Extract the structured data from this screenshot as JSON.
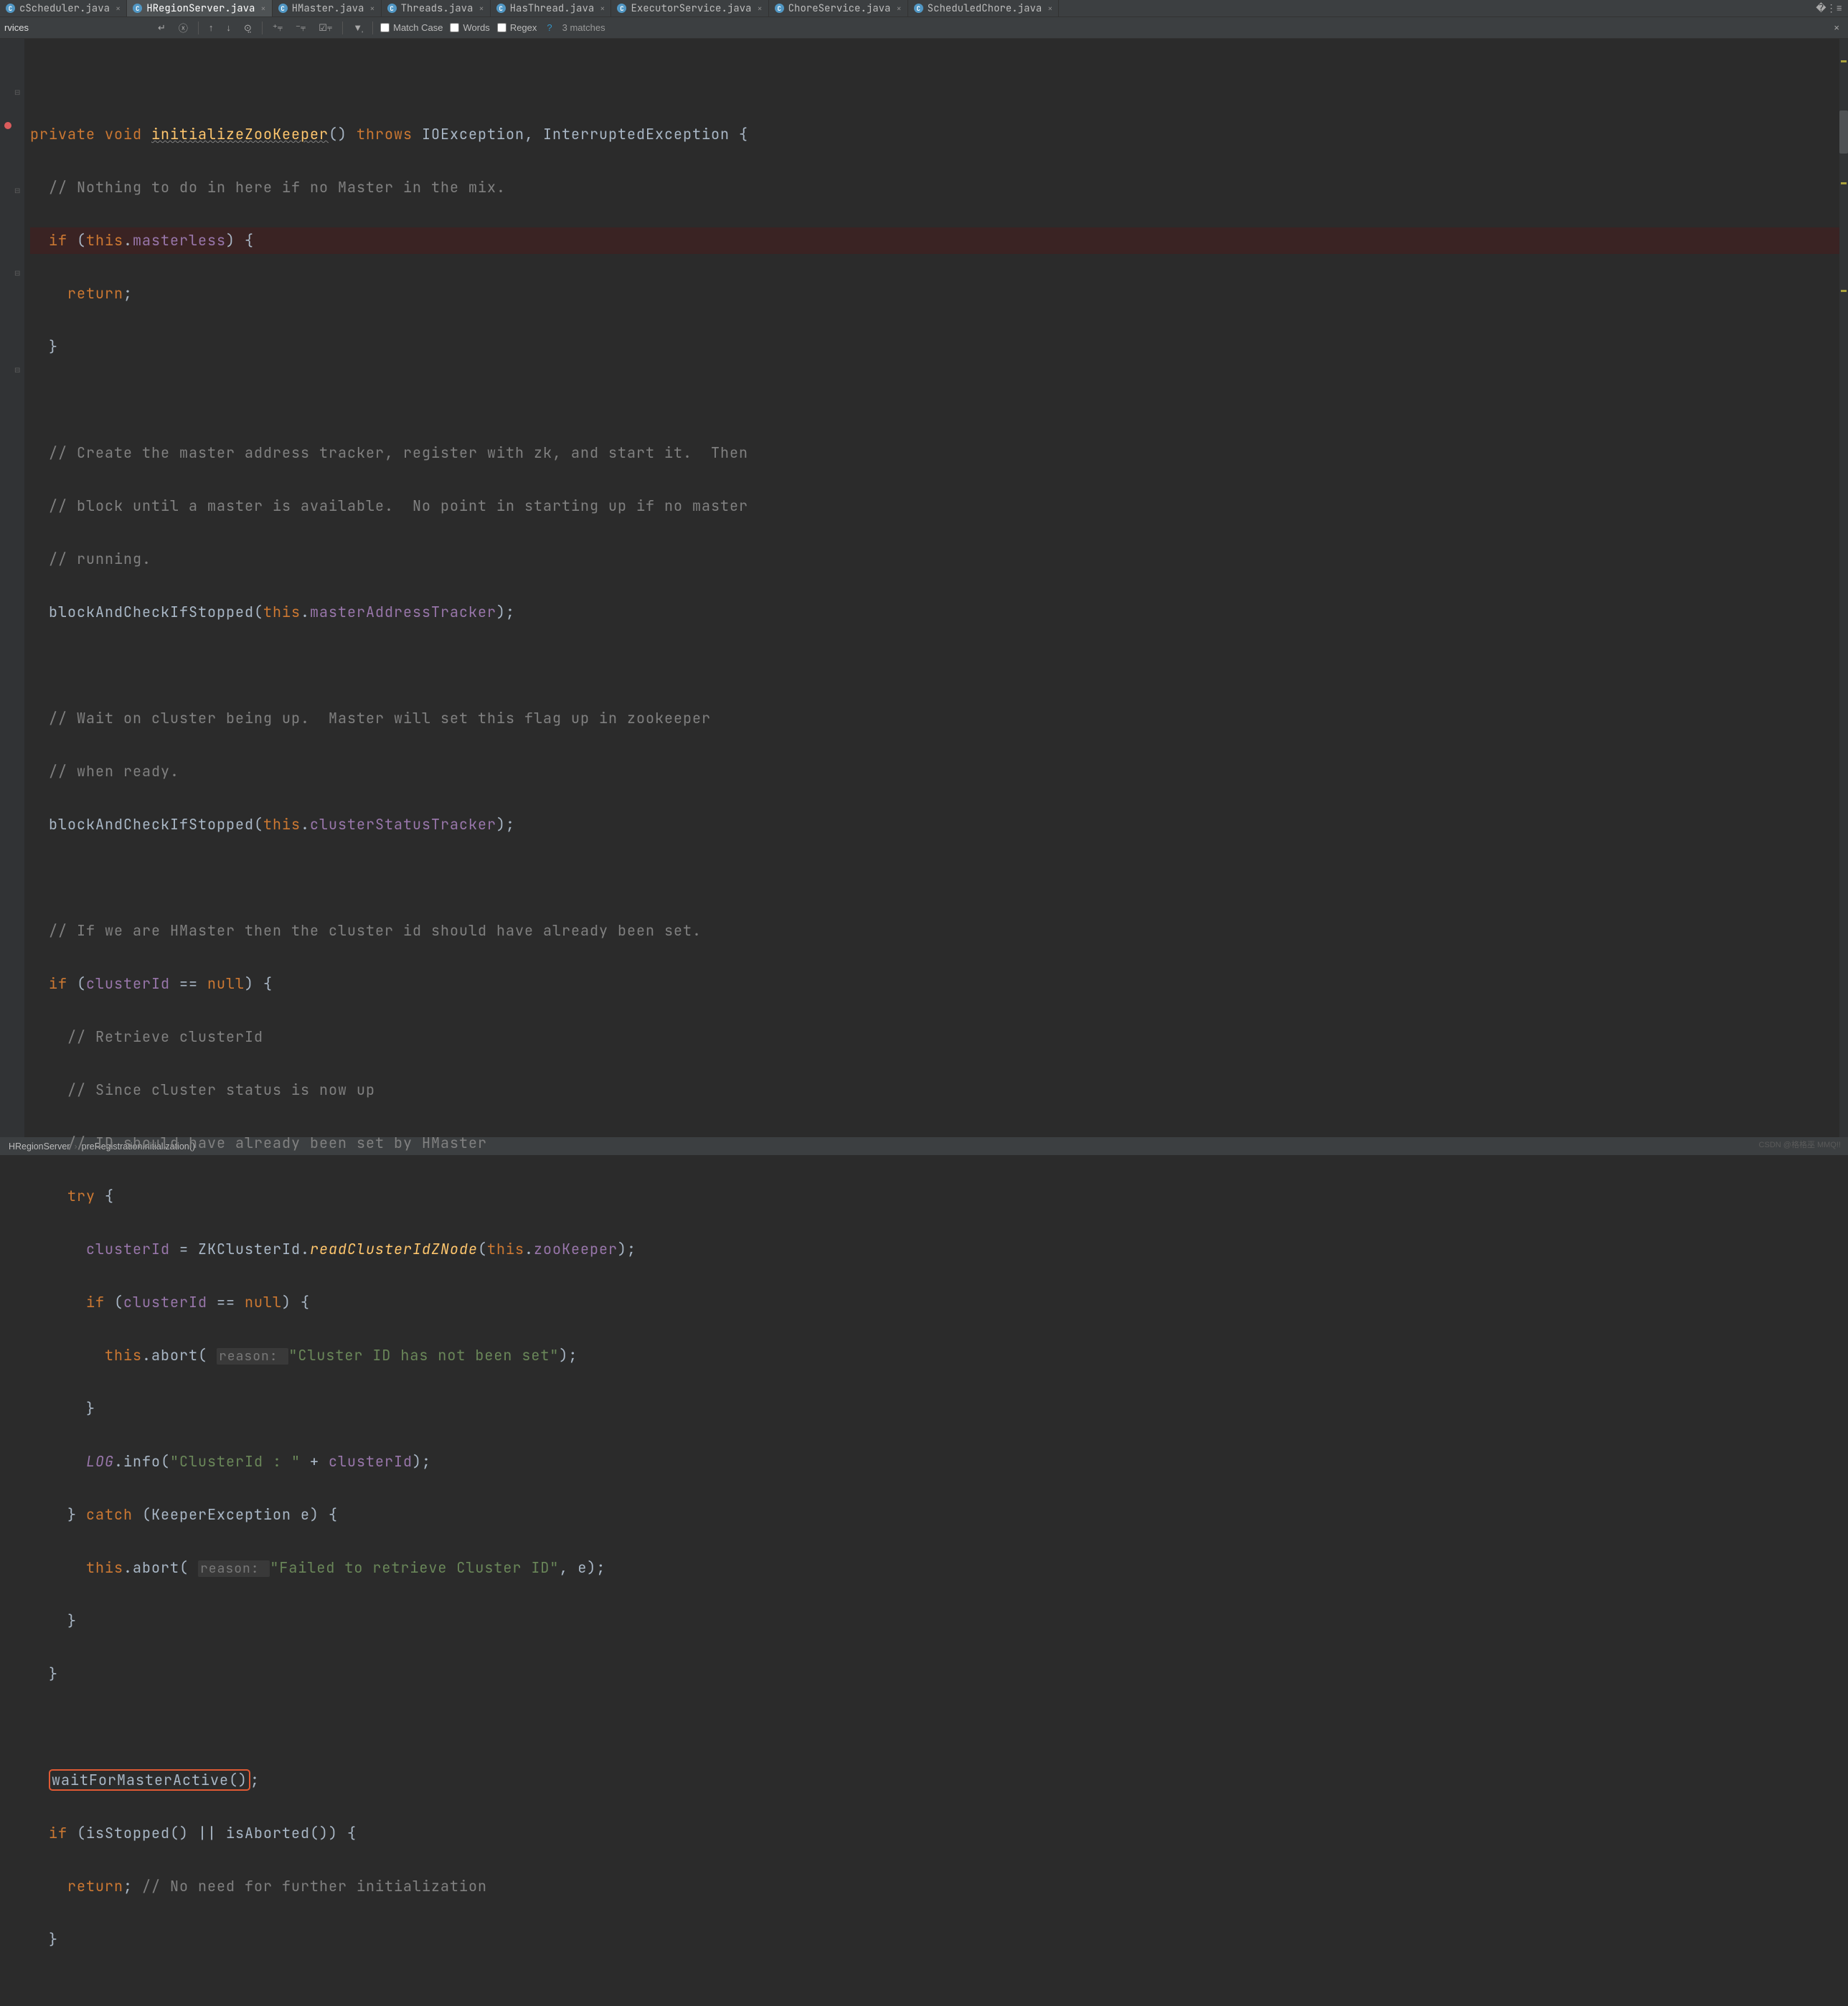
{
  "tabs": [
    {
      "label": "cScheduler.java",
      "icon": "class",
      "active": false
    },
    {
      "label": "HRegionServer.java",
      "icon": "class",
      "active": true
    },
    {
      "label": "HMaster.java",
      "icon": "class",
      "active": false
    },
    {
      "label": "Threads.java",
      "icon": "class",
      "active": false
    },
    {
      "label": "HasThread.java",
      "icon": "class",
      "active": false
    },
    {
      "label": "ExecutorService.java",
      "icon": "class",
      "active": false
    },
    {
      "label": "ChoreService.java",
      "icon": "class",
      "active": false
    },
    {
      "label": "ScheduledChore.java",
      "icon": "class",
      "active": false
    }
  ],
  "find": {
    "input": "rvices",
    "match_case": "Match Case",
    "words": "Words",
    "regex": "Regex",
    "matches": "3 matches"
  },
  "breadcrumb": {
    "c1": "HRegionServer",
    "c2": "preRegistrationInitialization()"
  },
  "code": {
    "l01a": "private void ",
    "l01b": "initializeZooKeeper",
    "l01c": "() ",
    "l01d": "throws ",
    "l01e": "IOException, InterruptedException {",
    "l02": "  // Nothing to do in here if no Master in the mix.",
    "l03a": "  if ",
    "l03b": "(",
    "l03c": "this",
    "l03d": ".",
    "l03e": "masterless",
    "l03f": ") {",
    "l04a": "    return",
    "l04b": ";",
    "l05": "  }",
    "l07": "  // Create the master address tracker, register with zk, and start it.  Then",
    "l08": "  // block until a master is available.  No point in starting up if no master",
    "l09": "  // running.",
    "l10a": "  blockAndCheckIfStopped(",
    "l10b": "this",
    "l10c": ".",
    "l10d": "masterAddressTracker",
    "l10e": ");",
    "l12": "  // Wait on cluster being up.  Master will set this flag up in zookeeper",
    "l13": "  // when ready.",
    "l14a": "  blockAndCheckIfStopped(",
    "l14b": "this",
    "l14c": ".",
    "l14d": "clusterStatusTracker",
    "l14e": ");",
    "l16": "  // If we are HMaster then the cluster id should have already been set.",
    "l17a": "  if ",
    "l17b": "(",
    "l17c": "clusterId",
    "l17d": " == ",
    "l17e": "null",
    "l17f": ") {",
    "l18": "    // Retrieve clusterId",
    "l19": "    // Since cluster status is now up",
    "l20": "    // ID should have already been set by HMaster",
    "l21a": "    try ",
    "l21b": "{",
    "l22a": "      ",
    "l22b": "clusterId",
    "l22c": " = ZKClusterId.",
    "l22d": "readClusterIdZNode",
    "l22e": "(",
    "l22f": "this",
    "l22g": ".",
    "l22h": "zooKeeper",
    "l22i": ");",
    "l23a": "      if ",
    "l23b": "(",
    "l23c": "clusterId",
    "l23d": " == ",
    "l23e": "null",
    "l23f": ") {",
    "l24a": "        this",
    "l24b": ".abort( ",
    "l24h": "reason: ",
    "l24c": "\"Cluster ID has not been set\"",
    "l24d": ");",
    "l25": "      }",
    "l26a": "      ",
    "l26b": "LOG",
    "l26c": ".info(",
    "l26d": "\"ClusterId : \"",
    "l26e": " + ",
    "l26f": "clusterId",
    "l26g": ");",
    "l27a": "    } ",
    "l27b": "catch ",
    "l27c": "(KeeperException e) {",
    "l28a": "      this",
    "l28b": ".abort( ",
    "l28h": "reason: ",
    "l28c": "\"Failed to retrieve Cluster ID\"",
    "l28d": ", e);",
    "l29": "    }",
    "l30": "  }",
    "l32a": "  ",
    "l32b": "waitForMasterActive()",
    "l32c": ";",
    "l33a": "  if ",
    "l33b": "(isStopped() || isAborted()) {",
    "l34a": "    return",
    "l34b": "; ",
    "l34c": "// No need for further initialization",
    "l35": "  }"
  },
  "watermark": "CSDN @格格巫 MMQ!!"
}
